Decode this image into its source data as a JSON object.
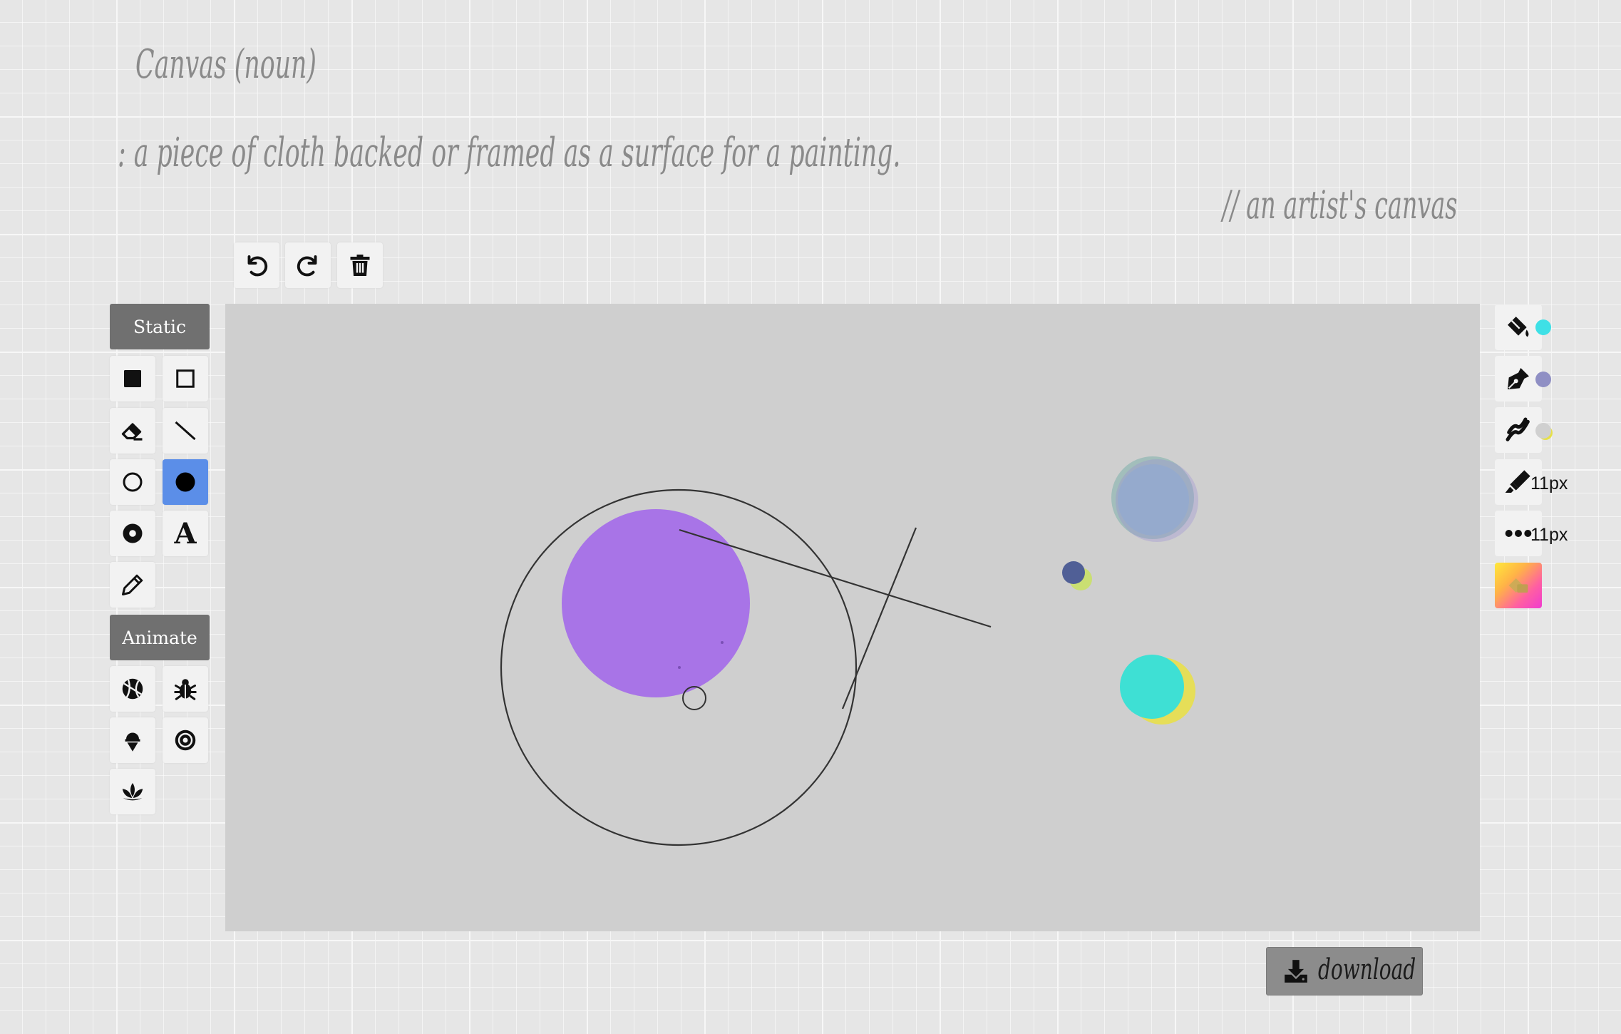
{
  "definition": {
    "title": "Canvas (noun)",
    "meaning": ": a piece of cloth backed or framed as a surface for a painting.",
    "example": "// an artist's canvas"
  },
  "history_toolbar": {
    "undo_icon": "undo-icon",
    "redo_icon": "redo-icon",
    "clear_icon": "trash-icon"
  },
  "tool_sections": {
    "static_label": "Static",
    "animate_label": "Animate"
  },
  "static_tools": [
    {
      "name": "filled-rectangle",
      "icon": "filled-square-icon"
    },
    {
      "name": "outline-rectangle",
      "icon": "outline-square-icon"
    },
    {
      "name": "eraser",
      "icon": "eraser-icon"
    },
    {
      "name": "line",
      "icon": "line-icon"
    },
    {
      "name": "outline-circle",
      "icon": "outline-circle-icon"
    },
    {
      "name": "filled-circle",
      "icon": "filled-circle-icon",
      "active": true
    },
    {
      "name": "ring",
      "icon": "ring-icon"
    },
    {
      "name": "text",
      "icon": "text-icon",
      "glyph": "A"
    },
    {
      "name": "pencil",
      "icon": "pencil-icon"
    }
  ],
  "animate_tools": [
    {
      "name": "sketch-ball",
      "icon": "basketball-icon"
    },
    {
      "name": "bug",
      "icon": "bug-icon"
    },
    {
      "name": "ice-cream",
      "icon": "ice-cream-icon"
    },
    {
      "name": "record",
      "icon": "record-icon"
    },
    {
      "name": "lotus",
      "icon": "lotus-icon"
    }
  ],
  "style_panel": {
    "fill_color": "#3ee0e6",
    "stroke_color": "#8f8fc4",
    "gradient_colors": [
      "#d0d0d0",
      "#e6e04a"
    ],
    "stroke_width": "11px",
    "dash_size": "11px",
    "active_tool_color": "#5b8ee8"
  },
  "download": {
    "label": "download",
    "icon": "download-icon"
  }
}
